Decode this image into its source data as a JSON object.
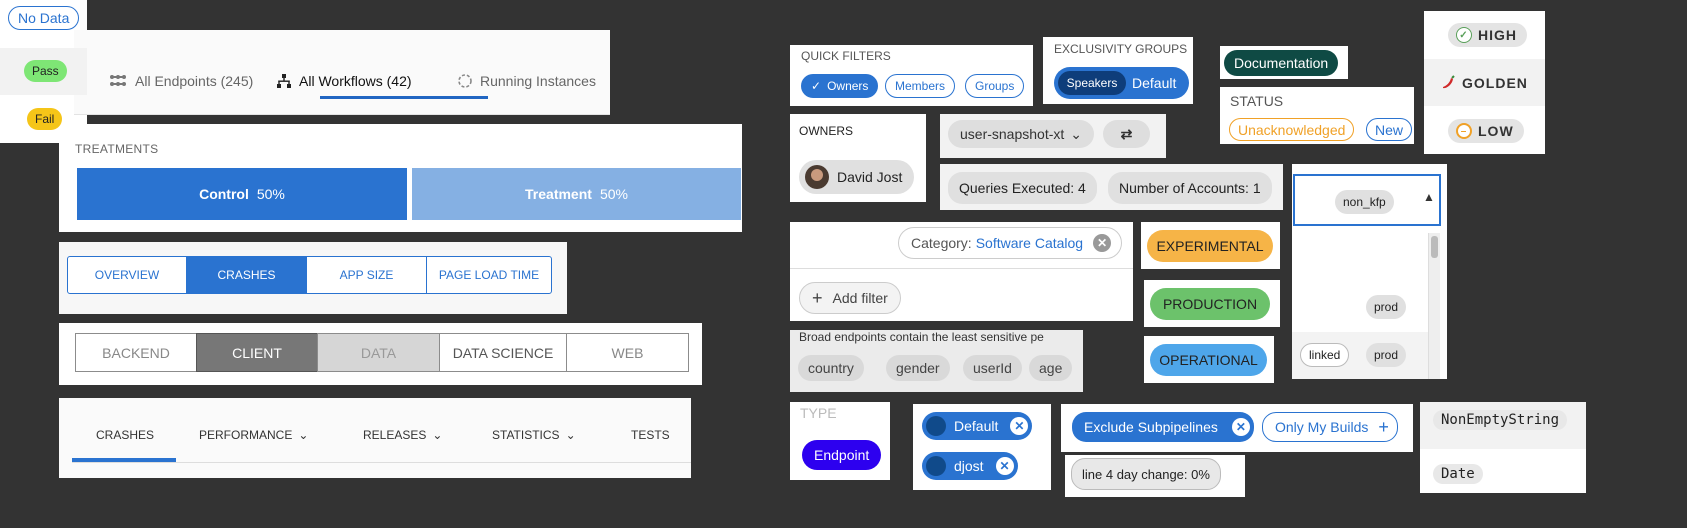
{
  "tabs_top": {
    "items": [
      {
        "label": "All Endpoints (245)",
        "icon": "endpoints-icon"
      },
      {
        "label": "All Workflows (42)",
        "icon": "workflow-icon",
        "active": true
      },
      {
        "label": "Running Instances",
        "icon": "spinner-icon"
      }
    ]
  },
  "treatments": {
    "label": "TREATMENTS",
    "segments": [
      {
        "name": "Control",
        "percent": "50%",
        "color": "#2a73d0"
      },
      {
        "name": "Treatment",
        "percent": "50%",
        "color": "#85b0e3"
      }
    ]
  },
  "button_group": {
    "items": [
      "OVERVIEW",
      "CRASHES",
      "APP SIZE",
      "PAGE LOAD TIME"
    ],
    "active": "CRASHES"
  },
  "segmented": {
    "items": [
      "BACKEND",
      "CLIENT",
      "DATA",
      "DATA SCIENCE",
      "WEB"
    ],
    "active": "CLIENT"
  },
  "menu_tabs": {
    "items": [
      {
        "label": "CRASHES",
        "dropdown": false
      },
      {
        "label": "PERFORMANCE",
        "dropdown": true
      },
      {
        "label": "RELEASES",
        "dropdown": true
      },
      {
        "label": "STATISTICS",
        "dropdown": true
      },
      {
        "label": "TESTS",
        "dropdown": false
      }
    ]
  },
  "quick_filters": {
    "label": "QUICK FILTERS",
    "chips": [
      "Owners",
      "Members",
      "Groups"
    ]
  },
  "exclusivity": {
    "label": "EXCLUSIVITY GROUPS",
    "selected": "Speakers",
    "other": "Default"
  },
  "documentation": {
    "label": "Documentation"
  },
  "status": {
    "label": "STATUS",
    "chips": [
      {
        "text": "Unacknowledged",
        "color": "#f0a127"
      },
      {
        "text": "New",
        "color": "#2a73d0"
      }
    ]
  },
  "priority": {
    "items": [
      {
        "text": "HIGH",
        "icon": "check-circle-icon"
      },
      {
        "text": "GOLDEN",
        "icon": "chili-pepper-icon"
      },
      {
        "text": "LOW",
        "icon": "minus-circle-icon"
      }
    ]
  },
  "owners": {
    "label": "OWNERS",
    "name": "David Jost"
  },
  "snapshot": {
    "label": "user-snapshot-xt"
  },
  "queries": {
    "chips": [
      "Queries Executed: 4",
      "Number of Accounts: 1"
    ]
  },
  "category_filter": {
    "key": "Category:",
    "value": "Software Catalog",
    "add_label": "Add filter"
  },
  "broad": {
    "text": "Broad endpoints contain the least sensitive pe",
    "chips": [
      "country",
      "gender",
      "userId",
      "age"
    ]
  },
  "environments": [
    {
      "text": "EXPERIMENTAL",
      "color": "#f6b447"
    },
    {
      "text": "PRODUCTION",
      "color": "#6cc26b"
    },
    {
      "text": "OPERATIONAL",
      "color": "#4ea6ea"
    }
  ],
  "dropdown": {
    "selected": "non_kfp",
    "options": [
      {
        "chips": [
          "prod"
        ]
      },
      {
        "chips": [
          "linked",
          "prod"
        ]
      }
    ]
  },
  "pass_fail": {
    "items": [
      {
        "text": "No Data",
        "style": "outline"
      },
      {
        "text": "Pass",
        "color": "#7ee675"
      },
      {
        "text": "Fail",
        "color": "#f5c518"
      }
    ]
  },
  "type": {
    "label": "TYPE",
    "chip": "Endpoint"
  },
  "pipelines": {
    "chips": [
      "Default",
      "djost"
    ]
  },
  "builds": {
    "exclude": "Exclude Subpipelines",
    "only_mine": "Only My Builds"
  },
  "line4": {
    "text": "line 4 day change: 0%"
  },
  "value_types": {
    "items": [
      "NonEmptyString",
      "Date"
    ]
  }
}
